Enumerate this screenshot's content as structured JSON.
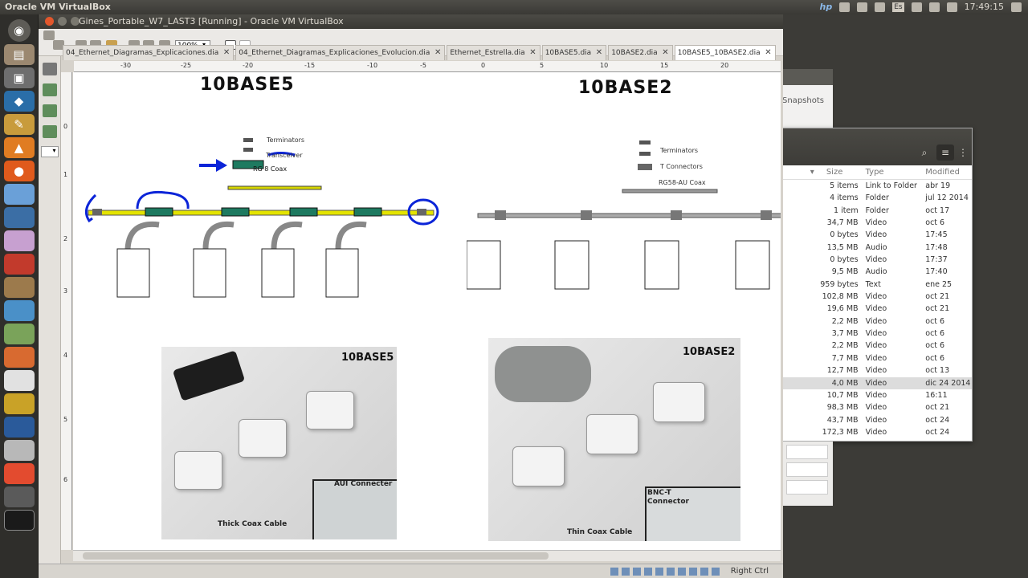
{
  "topbar": {
    "app_title": "Oracle VM VirtualBox",
    "lang": "Es",
    "time": "17:49:15"
  },
  "vbox": {
    "window_title": "Gines_Portable_W7_LAST3 [Running] - Oracle VM VirtualBox",
    "zoom": "100%",
    "status_hostkey": "Right Ctrl"
  },
  "tabs": [
    {
      "label": "04_Ethernet_Diagramas_Explicaciones.dia"
    },
    {
      "label": "04_Ethernet_Diagramas_Explicaciones_Evolucion.dia"
    },
    {
      "label": "Ethernet_Estrella.dia"
    },
    {
      "label": "10BASE5.dia"
    },
    {
      "label": "10BASE2.dia"
    },
    {
      "label": "10BASE5_10BASE2.dia"
    }
  ],
  "ruler": {
    "h": [
      "-30",
      "-25",
      "-20",
      "-15",
      "-10",
      "-5",
      "0",
      "5",
      "10",
      "15",
      "20"
    ],
    "v": [
      "0",
      "1",
      "2",
      "3",
      "4",
      "5",
      "6"
    ]
  },
  "diagram": {
    "left": {
      "title": "10BASE5",
      "terminators": "Terminators",
      "transceiver": "Transceiver",
      "coax": "RG 8 Coax"
    },
    "right": {
      "title": "10BASE2",
      "terminators": "Terminators",
      "t_connectors": "T Connectors",
      "coax": "RG58-AU Coax"
    },
    "photo_left": {
      "title": "10BASE5",
      "aui": "AUI Connecter",
      "cable": "Thick Coax Cable"
    },
    "photo_right": {
      "title": "10BASE2",
      "bnc1": "BNC-T",
      "bnc2": "Connector",
      "cable": "Thin Coax Cable"
    }
  },
  "bg_window": {
    "snapshots": "Snapshots"
  },
  "file_manager": {
    "columns": [
      "Size",
      "Type",
      "Modified"
    ],
    "rows": [
      {
        "size": "5 items",
        "type": "Link to Folder",
        "modified": "abr 19"
      },
      {
        "size": "4 items",
        "type": "Folder",
        "modified": "jul 12 2014"
      },
      {
        "size": "1 item",
        "type": "Folder",
        "modified": "oct 17"
      },
      {
        "size": "34,7 MB",
        "type": "Video",
        "modified": "oct 6"
      },
      {
        "size": "0 bytes",
        "type": "Video",
        "modified": "17:45"
      },
      {
        "size": "13,5 MB",
        "type": "Audio",
        "modified": "17:48"
      },
      {
        "size": "0 bytes",
        "type": "Video",
        "modified": "17:37"
      },
      {
        "size": "9,5 MB",
        "type": "Audio",
        "modified": "17:40"
      },
      {
        "size": "959 bytes",
        "type": "Text",
        "modified": "ene 25"
      },
      {
        "size": "102,8 MB",
        "type": "Video",
        "modified": "oct 21"
      },
      {
        "size": "19,6 MB",
        "type": "Video",
        "modified": "oct 21"
      },
      {
        "size": "2,2 MB",
        "type": "Video",
        "modified": "oct 6"
      },
      {
        "size": "3,7 MB",
        "type": "Video",
        "modified": "oct 6"
      },
      {
        "size": "2,2 MB",
        "type": "Video",
        "modified": "oct 6"
      },
      {
        "size": "7,7 MB",
        "type": "Video",
        "modified": "oct 6"
      },
      {
        "size": "12,7 MB",
        "type": "Video",
        "modified": "oct 13"
      },
      {
        "size": "4,0 MB",
        "type": "Video",
        "modified": "dic 24 2014"
      },
      {
        "size": "10,7 MB",
        "type": "Video",
        "modified": "16:11"
      },
      {
        "size": "98,3 MB",
        "type": "Video",
        "modified": "oct 21"
      },
      {
        "size": "43,7 MB",
        "type": "Video",
        "modified": "oct 24"
      },
      {
        "size": "172,3 MB",
        "type": "Video",
        "modified": "oct 24"
      }
    ]
  },
  "launcher_icons": [
    "ubuntu-icon",
    "files-icon",
    "camera-icon",
    "virtualbox-icon",
    "kolourpaint-icon",
    "audacity-icon",
    "firefox-icon",
    "app-icon",
    "app-icon",
    "app-icon",
    "app-icon",
    "app-icon",
    "app-icon",
    "app-icon",
    "app-icon",
    "app-icon",
    "app-icon",
    "app-icon",
    "app-icon",
    "app-icon",
    "app-icon",
    "app-icon",
    "app-icon"
  ]
}
